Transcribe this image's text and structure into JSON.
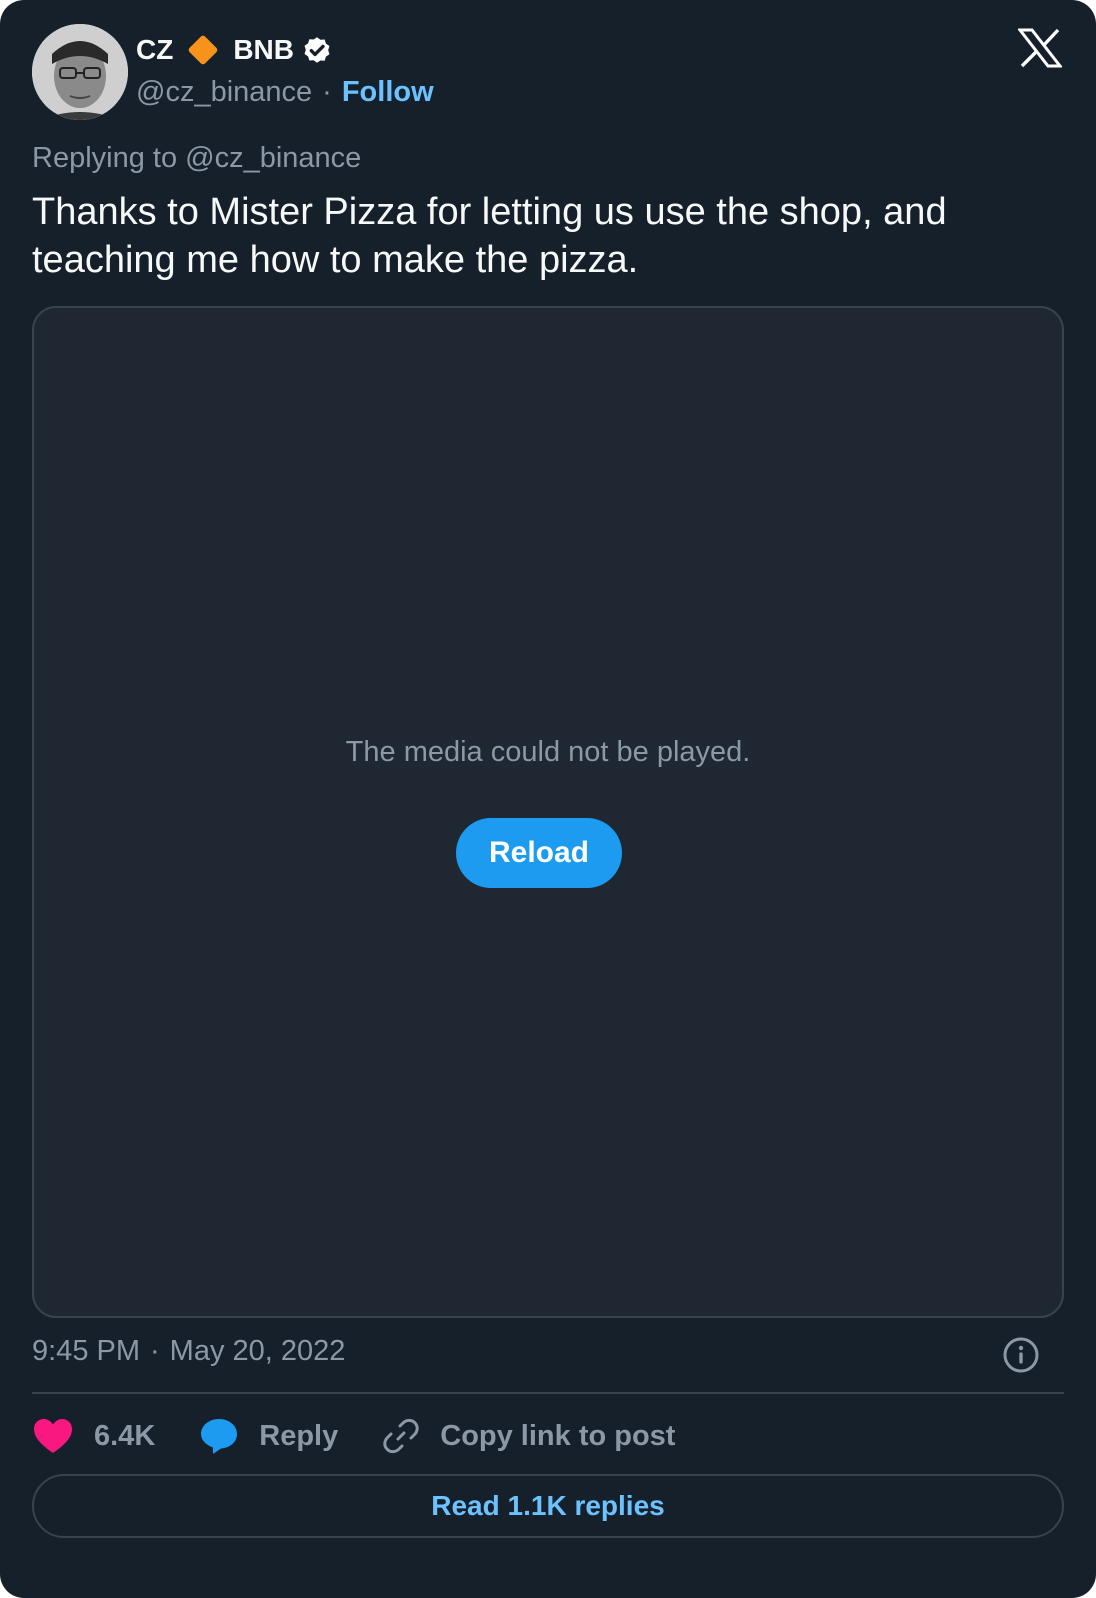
{
  "author": {
    "name": "CZ",
    "name_suffix": "BNB",
    "handle": "@cz_binance",
    "separator": "·",
    "follow_label": "Follow",
    "diamond_color": "#f7931a",
    "verified_icon": "verified-badge-icon"
  },
  "tweet": {
    "replying_to": "Replying to @cz_binance",
    "text": "Thanks to Mister Pizza for letting us use the shop, and teaching me how to make the pizza."
  },
  "media": {
    "message": "The media could not be played.",
    "reload_label": "Reload"
  },
  "meta": {
    "time": "9:45 PM",
    "separator": "·",
    "date": "May 20, 2022"
  },
  "actions": {
    "likes": "6.4K",
    "reply_label": "Reply",
    "copy_label": "Copy link to post"
  },
  "read_replies_label": "Read 1.1K replies",
  "colors": {
    "background": "#15202b",
    "accent": "#1d9bf0",
    "link": "#6cc1ff",
    "heart": "#f91880",
    "muted": "#8b98a5"
  }
}
